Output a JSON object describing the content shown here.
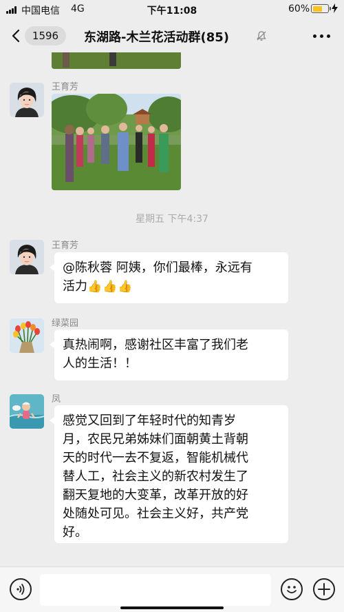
{
  "status_bar": {
    "carrier": "中国电信",
    "network": "4G",
    "time": "下午11:08",
    "battery": "60%"
  },
  "nav": {
    "unread_count": "1596",
    "title": "东湖路-木兰花活动群(85)"
  },
  "messages": [
    {
      "sender": "王育芳",
      "type": "image",
      "image_desc": "group-outdoor-photo"
    },
    {
      "sender": "王育芳",
      "type": "text",
      "text_line1": "@陈秋蓉 阿姨，你们最棒，永远有",
      "text_line2": "活力",
      "emoji": "👍👍👍"
    },
    {
      "sender": "绿菜园",
      "type": "text",
      "text_line1": "真热闹啊，感谢社区丰富了我们老",
      "text_line2": "人的生活！！"
    },
    {
      "sender": "凤",
      "type": "text",
      "lines": [
        "感觉又回到了年轻时代的知青岁",
        "月，农民兄弟姊妹们面朝黄土背朝",
        "天的时代一去不复返，智能机械代",
        "替人工，社会主义的新农村发生了",
        "翻天复地的大变革，改革开放的好",
        "处随处可见。社会主义好，共产党",
        "好。"
      ]
    }
  ],
  "timestamp": "星期五 下午4:37",
  "input": {
    "placeholder": ""
  },
  "colors": {
    "background": "#ededed",
    "bubble": "#ffffff",
    "name": "#888888",
    "battery": "#f7c41f"
  },
  "icons": [
    "signal-icon",
    "battery-icon",
    "back-icon",
    "mute-icon",
    "more-icon",
    "voice-icon",
    "emoji-icon",
    "add-icon"
  ]
}
